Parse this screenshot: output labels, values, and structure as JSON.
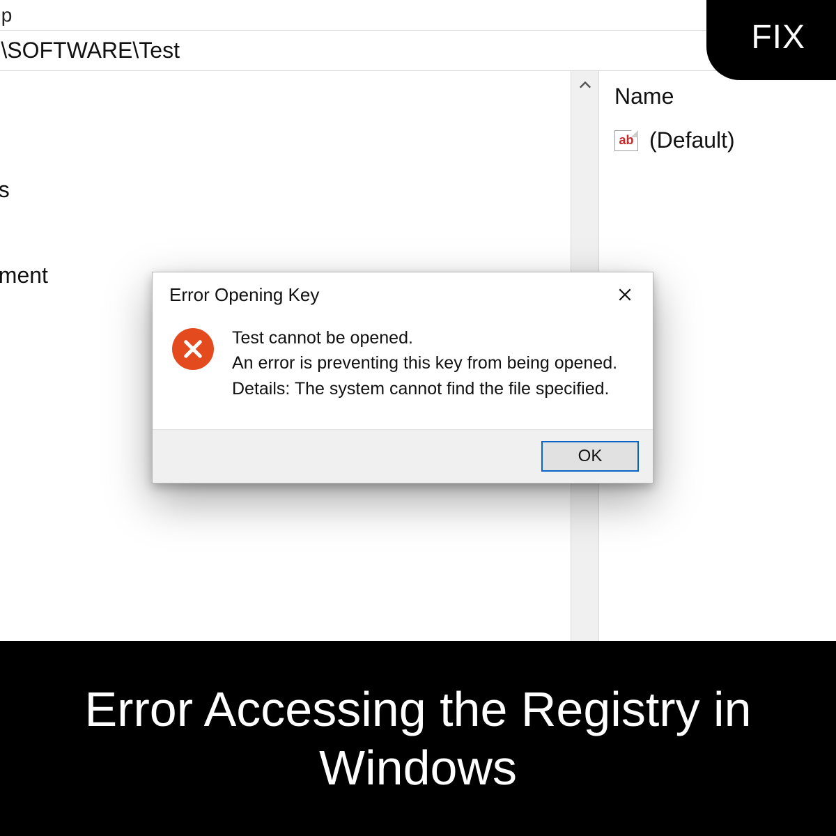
{
  "overlay": {
    "badge": "FIX",
    "caption": "Error Accessing the Registry in Windows"
  },
  "regedit": {
    "menu_help": "elp",
    "address_path": "E\\SOFTWARE\\Test",
    "tree_items": [
      "",
      "es",
      "",
      "nment"
    ],
    "values_header": "Name",
    "values_default_label": "(Default)",
    "ab_icon_text": "ab"
  },
  "dialog": {
    "title": "Error Opening Key",
    "line1": "Test cannot be opened.",
    "line2": "An error is preventing this key from being opened.",
    "line3": "Details: The system cannot find the file specified.",
    "ok_label": "OK"
  }
}
